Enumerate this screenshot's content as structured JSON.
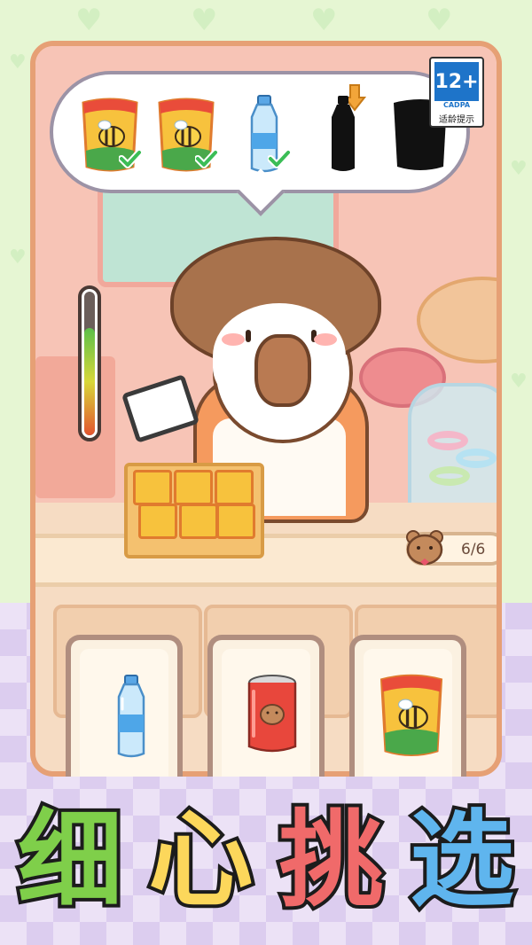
{
  "order": {
    "items": [
      {
        "name": "chips-bag",
        "status": "done"
      },
      {
        "name": "chips-bag",
        "status": "done"
      },
      {
        "name": "water-bottle",
        "status": "done"
      },
      {
        "name": "cola-bottle",
        "status": "pending-current"
      },
      {
        "name": "chips-bag",
        "status": "pending"
      }
    ]
  },
  "age_rating": {
    "age": "12+",
    "org": "CADPA",
    "tip": "适龄提示"
  },
  "patience_meter": {
    "level": 0.75
  },
  "customers": {
    "count": "6/6"
  },
  "choices": [
    {
      "name": "water-bottle"
    },
    {
      "name": "cola-can"
    },
    {
      "name": "chips-bag"
    }
  ],
  "title": {
    "chars": [
      "细",
      "心",
      "挑",
      "选"
    ]
  },
  "colors": {
    "frame": "#e6a075",
    "check": "#3bbd56",
    "arrow": "#f2a53a",
    "title_green": "#7fcf4a",
    "title_yellow": "#fcd75b",
    "title_red": "#f06a6a",
    "title_blue": "#5fb5ee"
  }
}
